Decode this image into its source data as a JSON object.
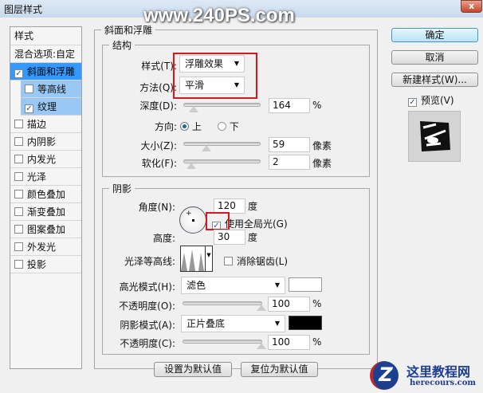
{
  "window": {
    "title": "图层样式",
    "close": "x"
  },
  "watermark": "www.240PS.com",
  "sidebar": {
    "header": "样式",
    "blend": "混合选项:自定",
    "items": [
      {
        "label": "斜面和浮雕",
        "checked": true
      },
      {
        "label": "等高线",
        "checked": false
      },
      {
        "label": "纹理",
        "checked": true
      },
      {
        "label": "描边",
        "checked": false
      },
      {
        "label": "内阴影",
        "checked": false
      },
      {
        "label": "内发光",
        "checked": false
      },
      {
        "label": "光泽",
        "checked": false
      },
      {
        "label": "颜色叠加",
        "checked": false
      },
      {
        "label": "渐变叠加",
        "checked": false
      },
      {
        "label": "图案叠加",
        "checked": false
      },
      {
        "label": "外发光",
        "checked": false
      },
      {
        "label": "投影",
        "checked": false
      }
    ]
  },
  "bevel": {
    "title": "斜面和浮雕",
    "structure": {
      "title": "结构",
      "style_label": "样式(T):",
      "style_value": "浮雕效果",
      "method_label": "方法(Q):",
      "method_value": "平滑",
      "depth_label": "深度(D):",
      "depth_value": "164",
      "depth_unit": "%",
      "direction_label": "方向:",
      "dir_up": "上",
      "dir_down": "下",
      "size_label": "大小(Z):",
      "size_value": "59",
      "size_unit": "像素",
      "soften_label": "软化(F):",
      "soften_value": "2",
      "soften_unit": "像素"
    },
    "shading": {
      "title": "阴影",
      "angle_label": "角度(N):",
      "angle_value": "120",
      "angle_unit": "度",
      "global_light": "使用全局光(G)",
      "altitude_label": "高度:",
      "altitude_value": "30",
      "altitude_unit": "度",
      "gloss_label": "光泽等高线:",
      "antialias": "消除锯齿(L)",
      "highlight_label": "高光模式(H):",
      "highlight_mode": "滤色",
      "highlight_color": "#ffffff",
      "opacity1_label": "不透明度(O):",
      "opacity1_value": "100",
      "pct": "%",
      "shadow_label": "阴影模式(A):",
      "shadow_mode": "正片叠底",
      "shadow_color": "#000000",
      "opacity2_label": "不透明度(C):",
      "opacity2_value": "100"
    },
    "make_default": "设置为默认值",
    "reset_default": "复位为默认值"
  },
  "right": {
    "ok": "确定",
    "cancel": "取消",
    "new_style": "新建样式(W)...",
    "preview": "预览(V)"
  },
  "logo": {
    "cn": "这里教程网",
    "en": "herecours.com"
  }
}
